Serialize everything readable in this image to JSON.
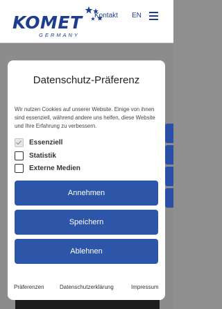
{
  "header": {
    "logo_text": "KOMET",
    "logo_sub": "GERMANY",
    "nav_contact": "Kontakt",
    "lang": "EN"
  },
  "consent": {
    "title": "Datenschutz-Präferenz",
    "description": "Wir nutzen Cookies auf unserer Website. Einige von ihnen sind essenziell, während andere uns helfen, diese Website und Ihre Erfahrung zu verbessern.",
    "options": [
      {
        "label": "Essenziell",
        "checked": true,
        "disabled": true
      },
      {
        "label": "Statistik",
        "checked": false
      },
      {
        "label": "Externe Medien",
        "checked": false
      }
    ],
    "buttons": {
      "accept": "Annehmen",
      "save": "Speichern",
      "reject": "Ablehnen"
    },
    "footer": {
      "preferences": "Präferenzen",
      "privacy": "Datenschutzerklärung",
      "imprint": "Impressum"
    }
  },
  "colors": {
    "brand": "#1d3d8f",
    "button": "#2d55a8",
    "overlay": "#8c8c8c"
  }
}
